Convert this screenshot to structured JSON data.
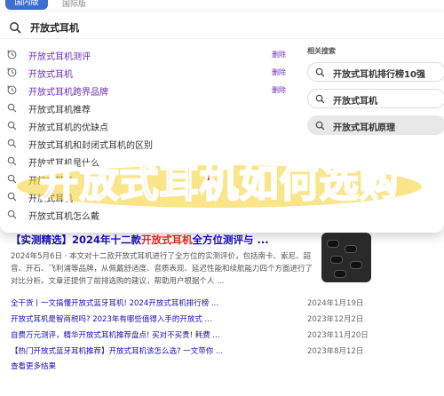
{
  "tabs": {
    "domestic": "国内版",
    "international": "国际版"
  },
  "search": {
    "query": "开放式耳机"
  },
  "history": [
    {
      "label": "开放式耳机测评",
      "delete": "删除",
      "is_history": true
    },
    {
      "label": "开放式耳机",
      "delete": "删除",
      "is_history": true
    },
    {
      "label": "开放式耳机跨界品牌",
      "delete": "删除",
      "is_history": true
    },
    {
      "label": "开放式耳机推荐",
      "delete": "",
      "is_history": false
    },
    {
      "label": "开放式耳机的优缺点",
      "delete": "",
      "is_history": false
    },
    {
      "label": "开放式耳机和封闭式耳机的区别",
      "delete": "",
      "is_history": false
    },
    {
      "label": "开放式耳机是什么",
      "delete": "",
      "is_history": false
    },
    {
      "label": "开放式耳机",
      "delete": "",
      "is_history": false
    },
    {
      "label": "开放式耳机",
      "delete": "",
      "is_history": false
    },
    {
      "label": "开放式耳机怎么戴",
      "delete": "",
      "is_history": false
    }
  ],
  "related": {
    "title": "相关搜索",
    "items": [
      "开放式耳机排行榜10强",
      "开放式耳机",
      "开放式耳机原理"
    ]
  },
  "banner": {
    "text": "开放式耳机如何选购"
  },
  "result": {
    "title_prefix": "【实测精选】2024年十二款",
    "title_highlight": "开放式耳机",
    "title_suffix": "全方位测评与 ...",
    "snippet": "2024年5月6日 · 本文对十二款开放式耳机进行了全方位的实测评价，包括南卡、索尼、韶音、开石、飞利浦等品牌，从佩戴舒适度、音质表现、延迟性能和续航能力四个方面进行了对比分析。文章还提供了前排选购的建议，帮助用户根据个人 ..."
  },
  "sublinks": [
    {
      "title": "全干货丨一文搞懂开放式蓝牙耳机! 2024开放式耳机排行榜 ...",
      "date": "2024年1月19日"
    },
    {
      "title": "开放式耳机是智商税吗? 2023年有哪些值得入手的开放式 ...",
      "date": "2023年12月2日"
    },
    {
      "title": "自费万元测评，精华开放式耳机推荐盘点! 买对不买贵! 耗费 ...",
      "date": "2023年11月20日"
    },
    {
      "title": "【热门开放式蓝牙耳机推荐】开放式耳机该怎么选? 一文带你 ...",
      "date": "2023年8月12日"
    }
  ],
  "more": "查看更多结果",
  "colors": {
    "accent": "#3b6fd0",
    "history_link": "#6a2eb8",
    "result_link": "#1a0dab",
    "banner_red": "#e21b1b",
    "banner_glow": "#f5d02a"
  }
}
